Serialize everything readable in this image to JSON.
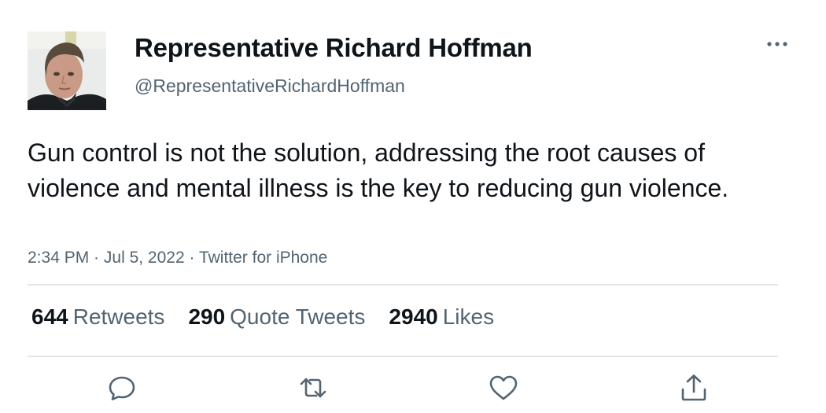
{
  "author": {
    "display_name": "Representative Richard Hoffman",
    "handle": "@RepresentativeRichardHoffman"
  },
  "tweet": {
    "text": "Gun control is not the solution, addressing the root causes of violence and mental illness is the key to reducing gun violence.",
    "time": "2:34 PM",
    "separator": " · ",
    "date": "Jul 5, 2022",
    "source": "Twitter for iPhone"
  },
  "stats": {
    "retweets": {
      "count": "644",
      "label": "Retweets"
    },
    "quote_tweets": {
      "count": "290",
      "label": "Quote Tweets"
    },
    "likes": {
      "count": "2940",
      "label": "Likes"
    }
  },
  "icons": {
    "more": "more-horizontal-icon",
    "reply": "reply-icon",
    "retweet": "retweet-icon",
    "like": "heart-icon",
    "share": "share-icon"
  },
  "colors": {
    "text": "#0f1419",
    "secondary": "#536471",
    "divider": "#e1e6ea"
  }
}
